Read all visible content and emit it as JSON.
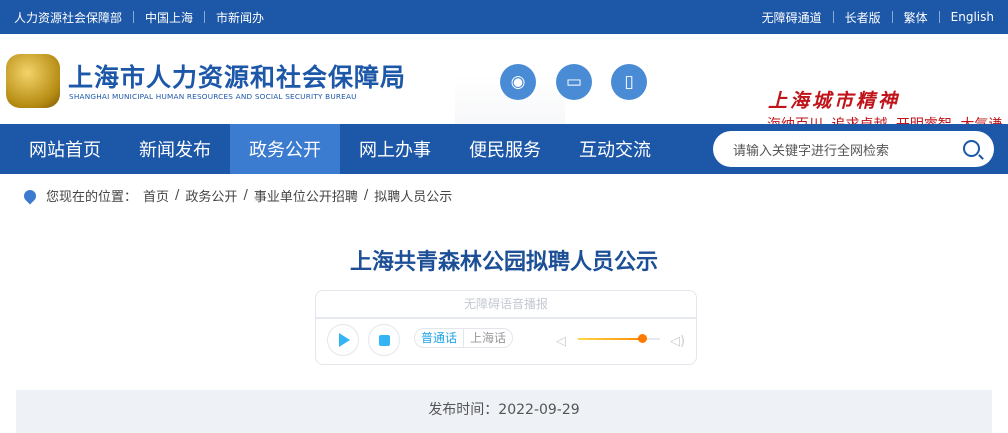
{
  "topbar": {
    "left": [
      "人力资源社会保障部",
      "中国上海",
      "市新闻办"
    ],
    "right": [
      "无障碍通道",
      "长者版",
      "繁体",
      "English"
    ]
  },
  "header": {
    "title": "上海市人力资源和社会保障局",
    "title_en": "SHANGHAI MUNICIPAL HUMAN RESOURCES AND SOCIAL SECURITY BUREAU",
    "icons": [
      "weibo-icon",
      "desktop-icon",
      "mobile-icon"
    ],
    "spirit": "上海城市精神",
    "motto": "海纳百川 追求卓越 开明睿智 大气谦和"
  },
  "nav": {
    "items": [
      "网站首页",
      "新闻发布",
      "政务公开",
      "网上办事",
      "便民服务",
      "互动交流"
    ],
    "active": "政务公开",
    "search_placeholder": "请输入关键字进行全网检索"
  },
  "breadcrumb": {
    "label": "您现在的位置：",
    "items": [
      "首页",
      "政务公开",
      "事业单位公开招聘",
      "拟聘人员公示"
    ]
  },
  "article": {
    "title": "上海共青森林公园拟聘人员公示",
    "publish": "发布时间：2022-09-29"
  },
  "player": {
    "label": "无障碍语音播报",
    "lang_on": "普通话",
    "lang_off": "上海话",
    "volume_percent": 78
  },
  "colors": {
    "brand": "#1c57a8",
    "accent": "#c0141a"
  }
}
